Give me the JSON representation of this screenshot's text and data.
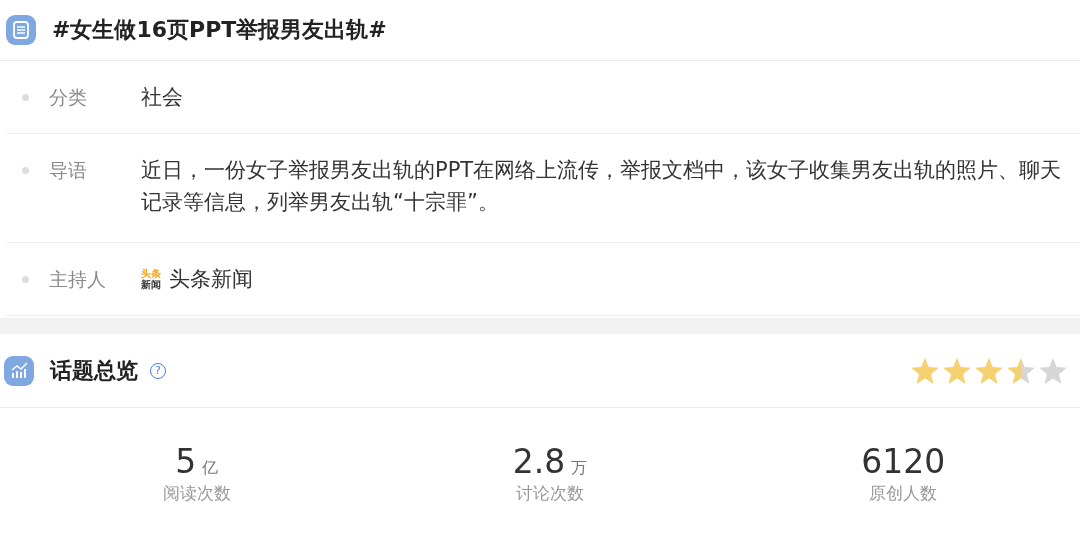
{
  "topic": {
    "title": "#女生做16页PPT举报男友出轨#"
  },
  "info": [
    {
      "kind": "text",
      "label": "分类",
      "value": "社会"
    },
    {
      "kind": "text",
      "label": "导语",
      "value": "近日，一份女子举报男友出轨的PPT在网络上流传，举报文档中，该女子收集男友出轨的照片、聊天记录等信息，列举男友出轨“十宗罪”。"
    },
    {
      "kind": "host",
      "label": "主持人",
      "value": "头条新闻",
      "logo_top": "头条",
      "logo_bottom": "新闻"
    }
  ],
  "overview": {
    "title": "话题总览",
    "help": "?",
    "stars": 3.5
  },
  "stats": [
    {
      "value": "5",
      "unit": "亿",
      "label": "阅读次数"
    },
    {
      "value": "2.8",
      "unit": "万",
      "label": "讨论次数"
    },
    {
      "value": "6120",
      "label": "原创人数"
    }
  ]
}
